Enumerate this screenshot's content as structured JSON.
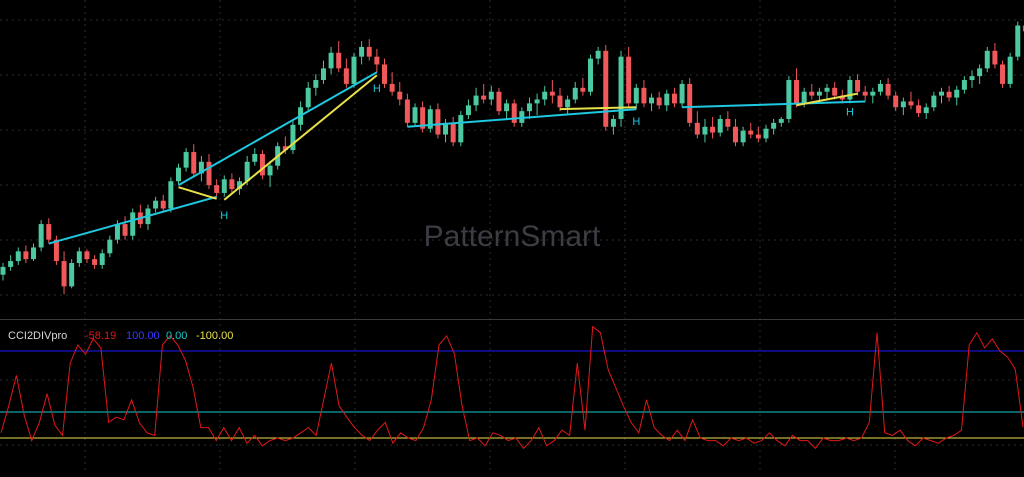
{
  "watermark": "PatternSmart",
  "colors": {
    "background": "#000000",
    "grid": "#2c2c2c",
    "bull": "#4cc9a0",
    "bear": "#f0585a",
    "trendline": "#1ec8e0",
    "divergence": "#e8e04a",
    "cci_line": "#e01818",
    "level_upper": "#1a1aff",
    "level_zero": "#18c8c8",
    "level_lower": "#e8e04a",
    "label_h": "#1ec8e0"
  },
  "indicator": {
    "name": "CCI2DIVpro",
    "current": "-58.19",
    "upper": "100.00",
    "zero": "0.00",
    "lower": "-100.00"
  },
  "chart_data": [
    {
      "type": "candlestick",
      "title": "",
      "grid": true,
      "ylim": [
        0,
        100
      ],
      "candles": [
        [
          28,
          34,
          25,
          32
        ],
        [
          32,
          38,
          30,
          35
        ],
        [
          35,
          42,
          33,
          40
        ],
        [
          40,
          43,
          34,
          36
        ],
        [
          36,
          44,
          35,
          42
        ],
        [
          42,
          56,
          40,
          54
        ],
        [
          54,
          57,
          44,
          46
        ],
        [
          46,
          48,
          33,
          35
        ],
        [
          35,
          40,
          18,
          22
        ],
        [
          22,
          36,
          21,
          34
        ],
        [
          34,
          42,
          32,
          40
        ],
        [
          40,
          41,
          34,
          36
        ],
        [
          36,
          38,
          31,
          33
        ],
        [
          33,
          41,
          31,
          39
        ],
        [
          39,
          48,
          37,
          46
        ],
        [
          46,
          56,
          44,
          54
        ],
        [
          54,
          58,
          46,
          48
        ],
        [
          48,
          62,
          46,
          60
        ],
        [
          60,
          64,
          52,
          54
        ],
        [
          54,
          64,
          51,
          62
        ],
        [
          62,
          68,
          60,
          66
        ],
        [
          66,
          69,
          60,
          62
        ],
        [
          62,
          78,
          60,
          76
        ],
        [
          76,
          85,
          74,
          83
        ],
        [
          83,
          93,
          81,
          91
        ],
        [
          91,
          95,
          78,
          80
        ],
        [
          80,
          89,
          76,
          86
        ],
        [
          86,
          90,
          72,
          74
        ],
        [
          74,
          77,
          68,
          70
        ],
        [
          70,
          79,
          68,
          77
        ],
        [
          77,
          80,
          70,
          72
        ],
        [
          72,
          78,
          69,
          76
        ],
        [
          76,
          89,
          74,
          86
        ],
        [
          86,
          93,
          84,
          90
        ],
        [
          90,
          92,
          77,
          79
        ],
        [
          79,
          86,
          73,
          84
        ],
        [
          84,
          96,
          82,
          94
        ],
        [
          94,
          99,
          90,
          92
        ],
        [
          92,
          107,
          90,
          105
        ],
        [
          105,
          117,
          102,
          114
        ],
        [
          114,
          127,
          112,
          124
        ],
        [
          124,
          131,
          120,
          128
        ],
        [
          128,
          138,
          126,
          134
        ],
        [
          134,
          145,
          131,
          142
        ],
        [
          142,
          148,
          132,
          134
        ],
        [
          134,
          139,
          124,
          126
        ],
        [
          126,
          142,
          124,
          140
        ],
        [
          140,
          148,
          136,
          145
        ],
        [
          145,
          149,
          138,
          140
        ],
        [
          140,
          144,
          132,
          136
        ],
        [
          136,
          139,
          124,
          126
        ],
        [
          126,
          132,
          120,
          122
        ],
        [
          122,
          127,
          115,
          118
        ],
        [
          118,
          121,
          104,
          106
        ],
        [
          106,
          116,
          104,
          114
        ],
        [
          114,
          117,
          101,
          103
        ],
        [
          103,
          115,
          101,
          113
        ],
        [
          113,
          116,
          98,
          100
        ],
        [
          100,
          108,
          96,
          106
        ],
        [
          106,
          109,
          94,
          96
        ],
        [
          96,
          112,
          94,
          110
        ],
        [
          110,
          118,
          108,
          115
        ],
        [
          115,
          124,
          112,
          120
        ],
        [
          120,
          126,
          116,
          118
        ],
        [
          118,
          125,
          115,
          122
        ],
        [
          122,
          124,
          110,
          112
        ],
        [
          112,
          118,
          108,
          116
        ],
        [
          116,
          118,
          104,
          106
        ],
        [
          106,
          114,
          104,
          112
        ],
        [
          112,
          119,
          108,
          116
        ],
        [
          116,
          121,
          110,
          118
        ],
        [
          118,
          125,
          115,
          122
        ],
        [
          122,
          128,
          116,
          120
        ],
        [
          120,
          124,
          112,
          114
        ],
        [
          114,
          120,
          110,
          118
        ],
        [
          118,
          127,
          116,
          124
        ],
        [
          124,
          129,
          120,
          122
        ],
        [
          122,
          141,
          120,
          139
        ],
        [
          139,
          145,
          136,
          143
        ],
        [
          143,
          146,
          102,
          104
        ],
        [
          104,
          110,
          100,
          108
        ],
        [
          108,
          143,
          104,
          140
        ],
        [
          140,
          145,
          114,
          116
        ],
        [
          116,
          126,
          113,
          124
        ],
        [
          124,
          128,
          114,
          116
        ],
        [
          116,
          121,
          112,
          119
        ],
        [
          119,
          122,
          113,
          115
        ],
        [
          115,
          123,
          112,
          121
        ],
        [
          121,
          124,
          114,
          116
        ],
        [
          116,
          128,
          114,
          126
        ],
        [
          126,
          129,
          104,
          106
        ],
        [
          106,
          112,
          98,
          100
        ],
        [
          100,
          108,
          96,
          104
        ],
        [
          104,
          109,
          98,
          101
        ],
        [
          101,
          110,
          99,
          108
        ],
        [
          108,
          112,
          102,
          104
        ],
        [
          104,
          108,
          94,
          96
        ],
        [
          96,
          104,
          94,
          102
        ],
        [
          102,
          106,
          98,
          100
        ],
        [
          100,
          104,
          96,
          98
        ],
        [
          98,
          105,
          96,
          103
        ],
        [
          103,
          108,
          100,
          106
        ],
        [
          106,
          109,
          104,
          108
        ],
        [
          108,
          130,
          106,
          128
        ],
        [
          128,
          134,
          114,
          116
        ],
        [
          116,
          124,
          114,
          122
        ],
        [
          122,
          126,
          118,
          120
        ],
        [
          120,
          124,
          116,
          122
        ],
        [
          122,
          126,
          118,
          124
        ],
        [
          124,
          127,
          118,
          120
        ],
        [
          120,
          123,
          116,
          118
        ],
        [
          118,
          130,
          116,
          128
        ],
        [
          128,
          131,
          120,
          122
        ],
        [
          122,
          125,
          117,
          120
        ],
        [
          120,
          124,
          116,
          122
        ],
        [
          122,
          128,
          120,
          126
        ],
        [
          126,
          129,
          118,
          120
        ],
        [
          120,
          122,
          112,
          114
        ],
        [
          114,
          119,
          110,
          117
        ],
        [
          117,
          122,
          113,
          115
        ],
        [
          115,
          118,
          109,
          111
        ],
        [
          111,
          116,
          108,
          114
        ],
        [
          114,
          122,
          112,
          120
        ],
        [
          120,
          124,
          116,
          122
        ],
        [
          122,
          125,
          117,
          119
        ],
        [
          119,
          125,
          115,
          123
        ],
        [
          123,
          130,
          121,
          128
        ],
        [
          128,
          133,
          124,
          130
        ],
        [
          130,
          136,
          126,
          134
        ],
        [
          134,
          145,
          132,
          143
        ],
        [
          143,
          147,
          134,
          136
        ],
        [
          136,
          138,
          124,
          126
        ],
        [
          126,
          142,
          124,
          140
        ],
        [
          140,
          158,
          138,
          156
        ],
        [
          156,
          162,
          150,
          153
        ],
        [
          153,
          160,
          148,
          158
        ],
        [
          158,
          162,
          152,
          154
        ],
        [
          154,
          162,
          150,
          160
        ],
        [
          160,
          162,
          154,
          156
        ],
        [
          156,
          160,
          150,
          152
        ],
        [
          152,
          160,
          150,
          158
        ],
        [
          158,
          163,
          146,
          148
        ],
        [
          148,
          154,
          136,
          138
        ]
      ]
    },
    {
      "type": "line",
      "title": "CCI2DIVpro",
      "ylim": [
        -150,
        150
      ],
      "levels": [
        100,
        0,
        -100
      ],
      "values": [
        -80,
        10,
        60,
        -10,
        -110,
        -40,
        30,
        -50,
        -90,
        80,
        110,
        95,
        120,
        105,
        -40,
        -20,
        -30,
        20,
        -40,
        -80,
        -90,
        110,
        125,
        110,
        85,
        40,
        -60,
        -60,
        -110,
        -60,
        -110,
        -60,
        -120,
        -90,
        -130,
        -110,
        -100,
        -110,
        -100,
        -80,
        -60,
        -90,
        20,
        80,
        10,
        -20,
        -60,
        -90,
        -110,
        -70,
        -40,
        -120,
        -80,
        -100,
        -110,
        -60,
        20,
        110,
        125,
        95,
        10,
        -110,
        -100,
        -130,
        -80,
        -90,
        -110,
        -100,
        -140,
        -110,
        -60,
        -130,
        -110,
        -70,
        -90,
        80,
        -70,
        140,
        130,
        70,
        40,
        10,
        -40,
        -80,
        20,
        -60,
        -90,
        -110,
        -70,
        -110,
        -30,
        -100,
        -110,
        -110,
        -130,
        -100,
        -110,
        -100,
        -120,
        -110,
        -80,
        -110,
        -130,
        -90,
        -110,
        -110,
        -140,
        -100,
        -110,
        -110,
        -100,
        -110,
        -100,
        -40,
        130,
        -80,
        -90,
        -70,
        -110,
        -130,
        -100,
        -110,
        -120,
        -100,
        -90,
        -70,
        110,
        130,
        105,
        120,
        100,
        90,
        70,
        -58
      ]
    }
  ]
}
